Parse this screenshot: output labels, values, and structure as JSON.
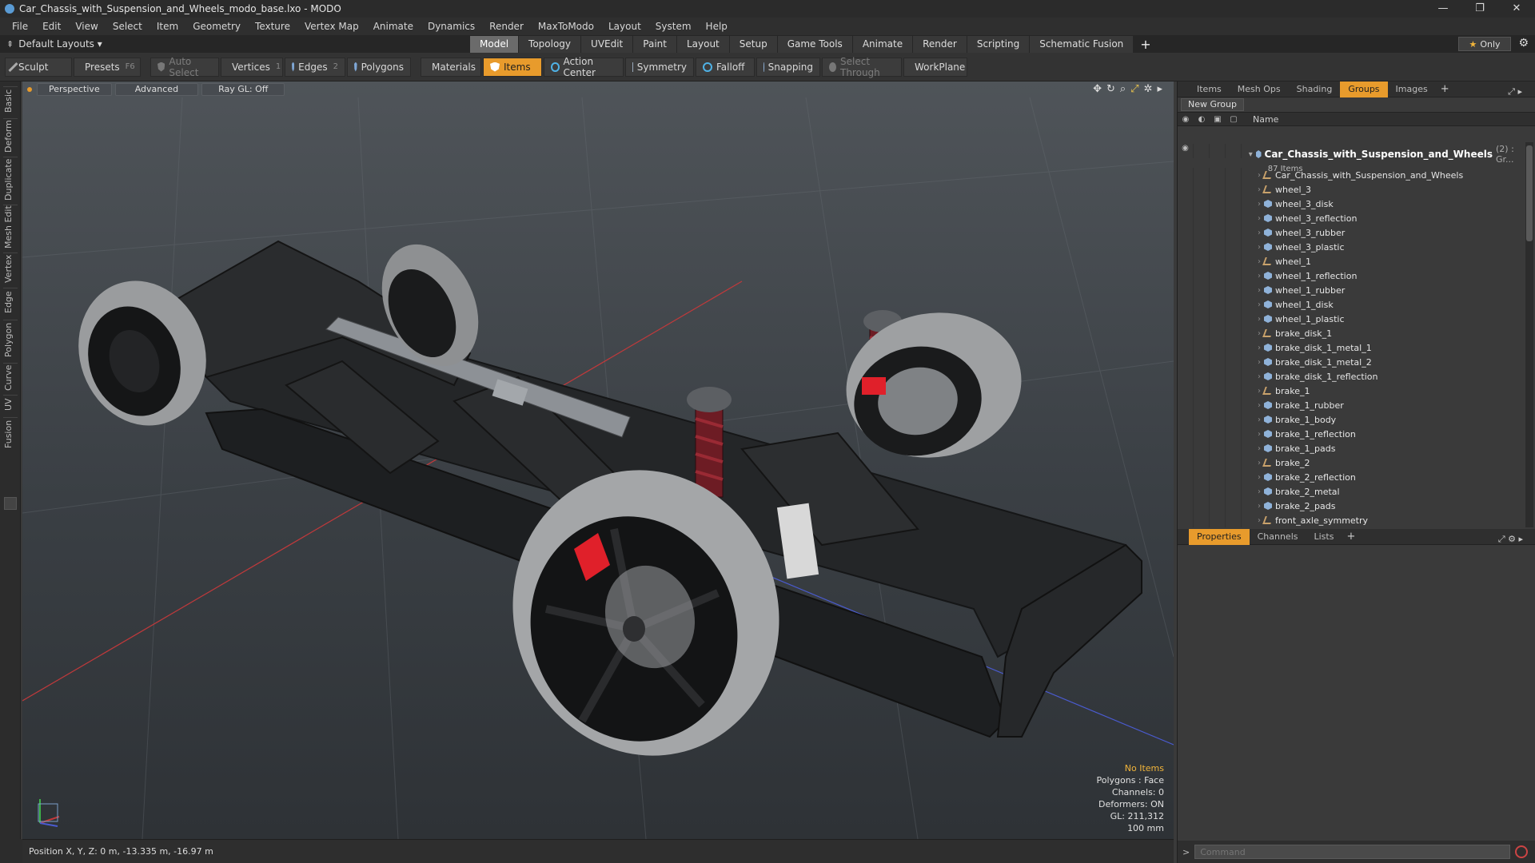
{
  "window": {
    "title": "Car_Chassis_with_Suspension_and_Wheels_modo_base.lxo - MODO",
    "min": "—",
    "max": "❐",
    "close": "✕"
  },
  "menu": [
    "File",
    "Edit",
    "View",
    "Select",
    "Item",
    "Geometry",
    "Texture",
    "Vertex Map",
    "Animate",
    "Dynamics",
    "Render",
    "MaxToModo",
    "Layout",
    "System",
    "Help"
  ],
  "layoutbar": {
    "preset": "Default Layouts ▾",
    "tabs": [
      "Model",
      "Topology",
      "UVEdit",
      "Paint",
      "Layout",
      "Setup",
      "Game Tools",
      "Animate",
      "Render",
      "Scripting",
      "Schematic Fusion"
    ],
    "active_tab": "Model",
    "plus": "+",
    "only": "Only"
  },
  "toolbar": {
    "sculpt": "Sculpt",
    "presets": "Presets",
    "presets_key": "F6",
    "auto_select": "Auto Select",
    "vertices": "Vertices",
    "vertices_key": "1",
    "edges": "Edges",
    "edges_key": "2",
    "polygons": "Polygons",
    "materials": "Materials",
    "items": "Items",
    "action_center": "Action Center",
    "symmetry": "Symmetry",
    "falloff": "Falloff",
    "snapping": "Snapping",
    "select_through": "Select Through",
    "workplane": "WorkPlane"
  },
  "leftstrip": [
    "Basic",
    "Deform",
    "Duplicate",
    "Mesh Edit",
    "Vertex",
    "Edge",
    "Polygon",
    "Curve",
    "UV",
    "Fusion"
  ],
  "viewport": {
    "view": "Perspective",
    "shading": "Advanced",
    "raygl": "Ray GL: Off",
    "info": {
      "selection": "No Items",
      "polygons": "Polygons : Face",
      "channels": "Channels: 0",
      "deformers": "Deformers: ON",
      "gl": "GL: 211,312",
      "scale": "100 mm"
    }
  },
  "status": {
    "position": "Position X, Y, Z:  0 m, -13.335 m, -16.97 m"
  },
  "itempanel": {
    "tabs": [
      "Items",
      "Mesh Ops",
      "Shading",
      "Groups",
      "Images"
    ],
    "active_tab": "Groups",
    "plus": "+",
    "new_group": "New Group",
    "name_col": "Name",
    "group": {
      "name": "Car_Chassis_with_Suspension_and_Wheels",
      "count": "(2) : Gr...",
      "subtitle": "87 Items"
    },
    "children": [
      {
        "name": "Car_Chassis_with_Suspension_and_Wheels",
        "type": "locator"
      },
      {
        "name": "wheel_3",
        "type": "locator"
      },
      {
        "name": "wheel_3_disk",
        "type": "mesh"
      },
      {
        "name": "wheel_3_reflection",
        "type": "mesh"
      },
      {
        "name": "wheel_3_rubber",
        "type": "mesh"
      },
      {
        "name": "wheel_3_plastic",
        "type": "mesh"
      },
      {
        "name": "wheel_1",
        "type": "locator"
      },
      {
        "name": "wheel_1_reflection",
        "type": "mesh"
      },
      {
        "name": "wheel_1_rubber",
        "type": "mesh"
      },
      {
        "name": "wheel_1_disk",
        "type": "mesh"
      },
      {
        "name": "wheel_1_plastic",
        "type": "mesh"
      },
      {
        "name": "brake_disk_1",
        "type": "locator"
      },
      {
        "name": "brake_disk_1_metal_1",
        "type": "mesh"
      },
      {
        "name": "brake_disk_1_metal_2",
        "type": "mesh"
      },
      {
        "name": "brake_disk_1_reflection",
        "type": "mesh"
      },
      {
        "name": "brake_1",
        "type": "locator"
      },
      {
        "name": "brake_1_rubber",
        "type": "mesh"
      },
      {
        "name": "brake_1_body",
        "type": "mesh"
      },
      {
        "name": "brake_1_reflection",
        "type": "mesh"
      },
      {
        "name": "brake_1_pads",
        "type": "mesh"
      },
      {
        "name": "brake_2",
        "type": "locator"
      },
      {
        "name": "brake_2_reflection",
        "type": "mesh"
      },
      {
        "name": "brake_2_metal",
        "type": "mesh"
      },
      {
        "name": "brake_2_pads",
        "type": "mesh"
      },
      {
        "name": "front_axle_symmetry",
        "type": "locator"
      }
    ]
  },
  "propspanel": {
    "tabs": [
      "Properties",
      "Channels",
      "Lists"
    ],
    "active_tab": "Properties",
    "plus": "+"
  },
  "command": {
    "placeholder": "Command",
    "arrow": ">"
  },
  "colors": {
    "accent": "#e89b2c",
    "brake_red": "#e0202a",
    "axis_red": "#c0393b",
    "axis_blue": "#4a5bd0"
  }
}
